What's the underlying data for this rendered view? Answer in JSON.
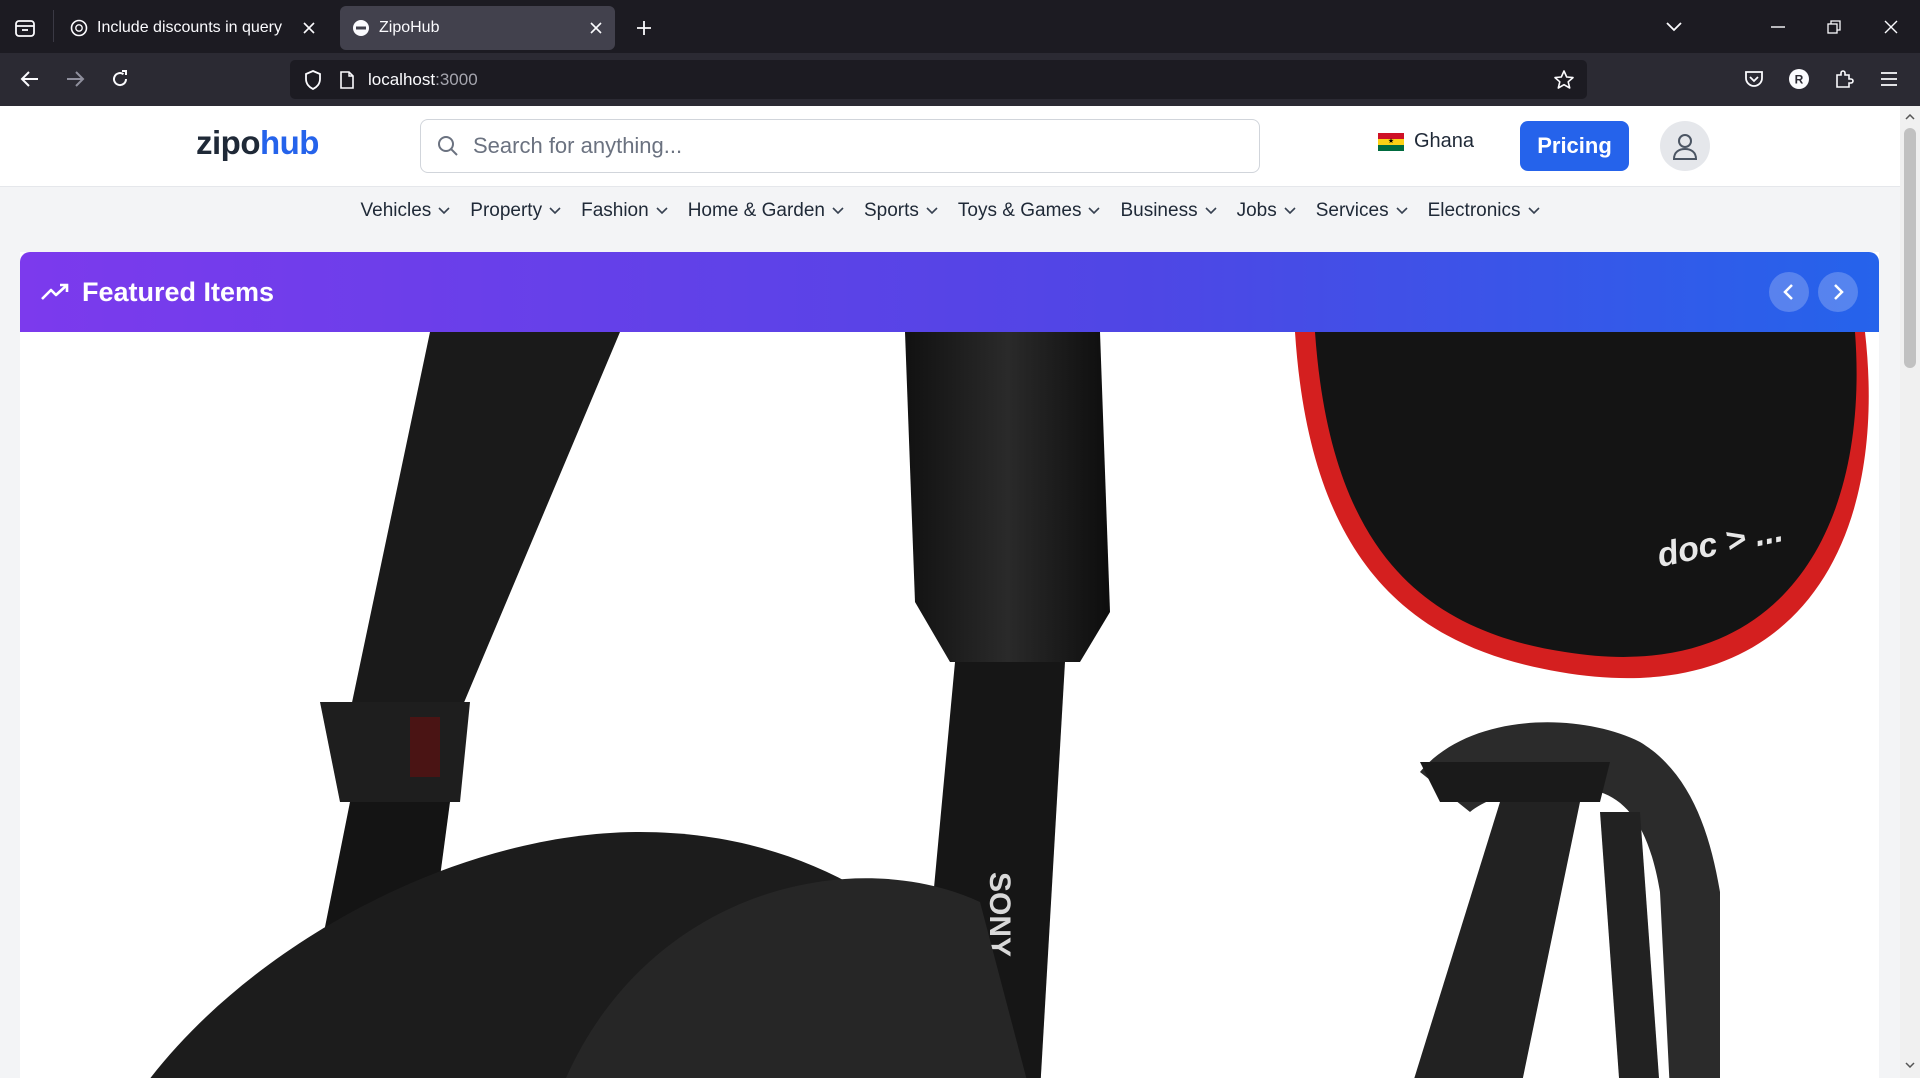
{
  "browser": {
    "tabs": [
      {
        "title": "Include discounts in query",
        "active": false
      },
      {
        "title": "ZipoHub",
        "active": true
      }
    ],
    "url_host": "localhost",
    "url_port": ":3000",
    "profile_initial": "R"
  },
  "header": {
    "logo_part1": "zipo",
    "logo_part2": "hub",
    "search_placeholder": "Search for anything...",
    "country": "Ghana",
    "pricing_label": "Pricing"
  },
  "categories": [
    "Vehicles",
    "Property",
    "Fashion",
    "Home & Garden",
    "Sports",
    "Toys & Games",
    "Business",
    "Jobs",
    "Services",
    "Electronics"
  ],
  "featured": {
    "title": "Featured Items",
    "image_brand_text": "SONY",
    "image_case_text": "doc > ..."
  },
  "colors": {
    "brand_blue": "#2563eb",
    "gradient_start": "#7c3aed",
    "gradient_end": "#2563eb",
    "tab_bar": "#1c1b22",
    "nav_bar": "#2b2a33"
  }
}
